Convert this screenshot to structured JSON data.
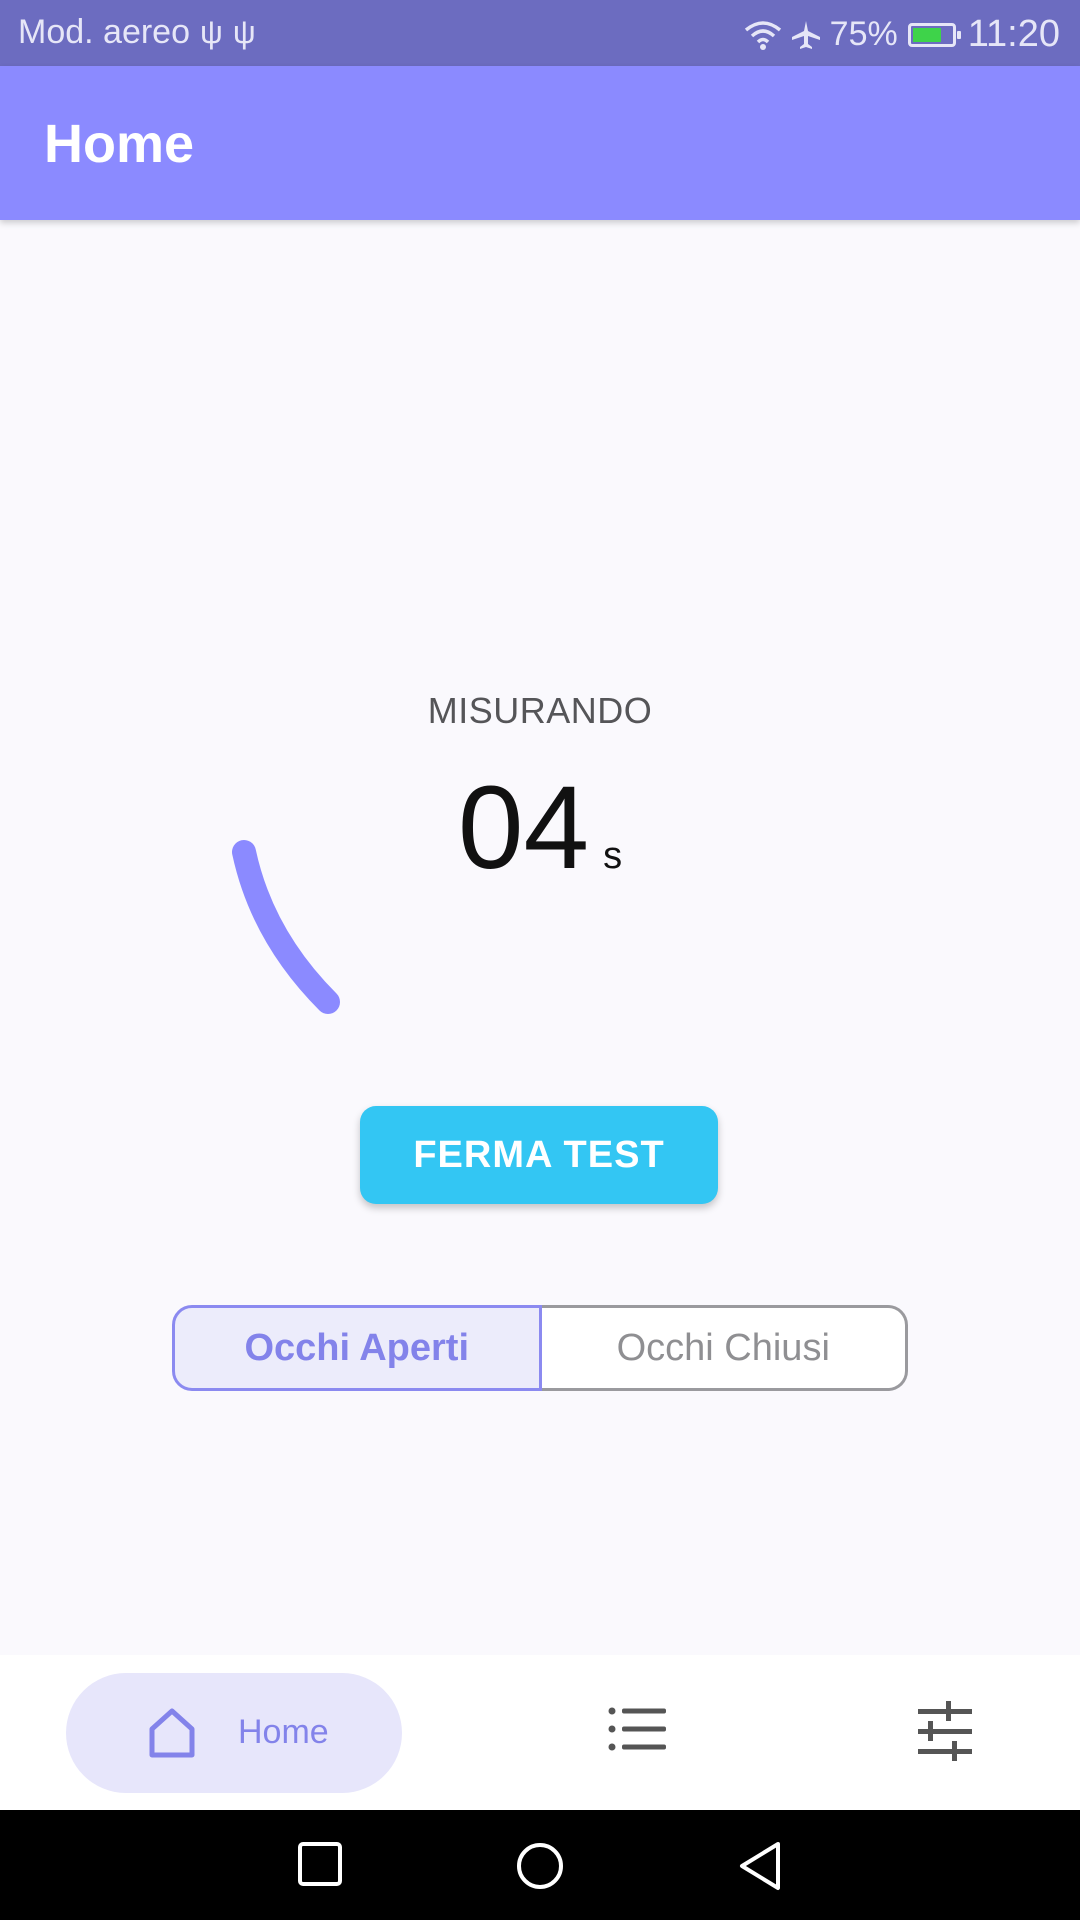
{
  "status_bar": {
    "left_text": "Mod. aereo",
    "usb_icons": [
      "usb-icon",
      "usb-icon"
    ],
    "battery_percent": "75%",
    "battery_level": 0.75,
    "time": "11:20"
  },
  "app_bar": {
    "title": "Home"
  },
  "measurement": {
    "status_label": "MISURANDO",
    "timer_value": "04",
    "timer_unit": "s"
  },
  "actions": {
    "stop_label": "FERMA TEST"
  },
  "mode_toggle": {
    "options": [
      {
        "label": "Occhi Aperti",
        "selected": true
      },
      {
        "label": "Occhi Chiusi",
        "selected": false
      }
    ]
  },
  "bottom_nav": {
    "items": [
      {
        "label": "Home",
        "icon": "home-icon",
        "active": true
      },
      {
        "label": "",
        "icon": "list-icon",
        "active": false
      },
      {
        "label": "",
        "icon": "settings-sliders-icon",
        "active": false
      }
    ]
  },
  "colors": {
    "status_bar": "#6c6cc0",
    "app_bar": "#8b8aff",
    "accent": "#8b8aff",
    "button": "#33c6f3",
    "background": "#faf9fd"
  }
}
